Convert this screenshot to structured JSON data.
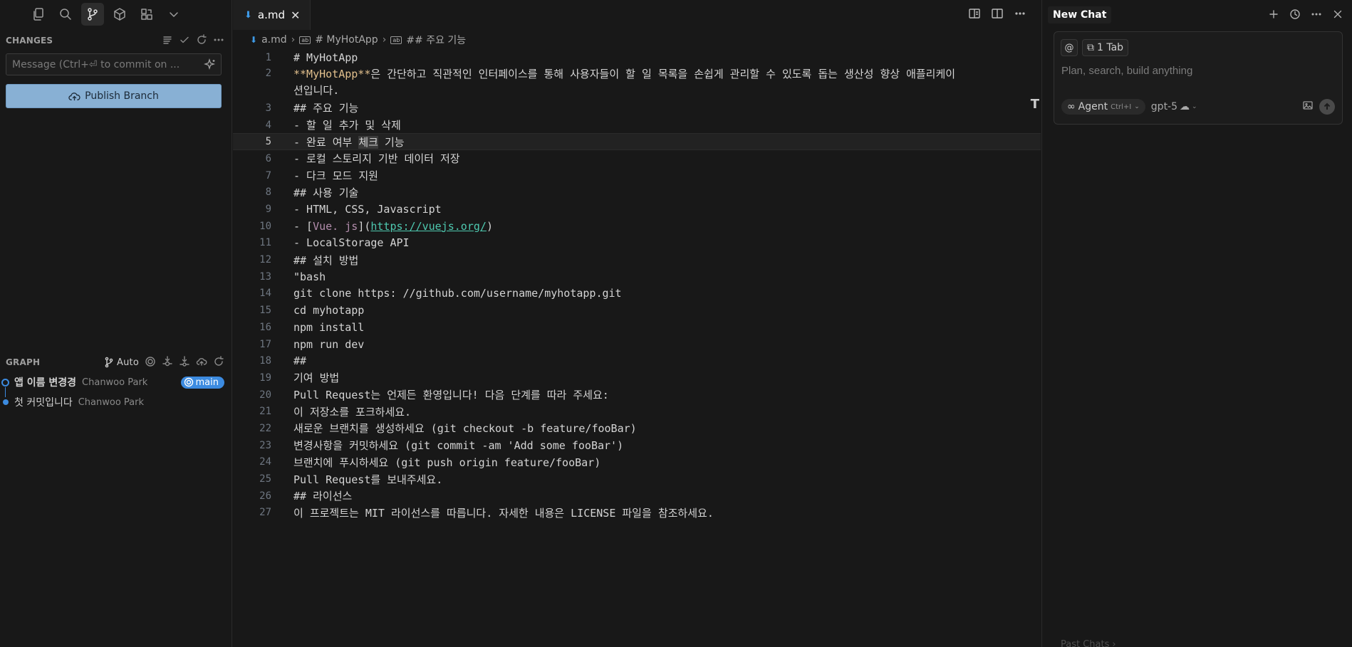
{
  "sidebar": {
    "changes_title": "CHANGES",
    "commit_placeholder": "Message (Ctrl+⏎ to commit on ...",
    "publish_label": "Publish Branch",
    "graph_title": "GRAPH",
    "graph_auto": "Auto",
    "commits": [
      {
        "message": "앱 이름 변경경",
        "author": "Chanwoo Park",
        "branch": "main"
      },
      {
        "message": "첫 커밋입니다",
        "author": "Chanwoo Park"
      }
    ]
  },
  "editor": {
    "tab_name": "a.md",
    "breadcrumb": [
      "a.md",
      "# MyHotApp",
      "## 주요 기능"
    ],
    "current_line": 5,
    "lines": [
      {
        "n": "1",
        "t": "# MyHotApp"
      },
      {
        "n": "2",
        "bold": "**MyHotApp**",
        "t": "은 간단하고 직관적인 인터페이스를 통해 사용자들이 할 일 목록을 손쉽게 관리할 수 있도록 돕는 생산성 향상 애플리케이션입니다."
      },
      {
        "n": "3",
        "t": "## 주요 기능"
      },
      {
        "n": "4",
        "t": "- 할 일 추가 및 삭제"
      },
      {
        "n": "5",
        "pre": "- 완료 여부 ",
        "hl": "체크",
        "post": " 기능"
      },
      {
        "n": "6",
        "t": "- 로컬 스토리지 기반 데이터 저장"
      },
      {
        "n": "7",
        "t": "- 다크 모드 지원"
      },
      {
        "n": "8",
        "t": "## 사용 기술"
      },
      {
        "n": "9",
        "t": "- HTML, CSS, Javascript"
      },
      {
        "n": "10",
        "pre": "- [",
        "link": "Vue. js",
        "mid": "](",
        "url": "https://vuejs.org/",
        "post": ")"
      },
      {
        "n": "11",
        "t": "- LocalStorage API"
      },
      {
        "n": "12",
        "t": "## 설치 방법"
      },
      {
        "n": "13",
        "t": "\"bash"
      },
      {
        "n": "14",
        "t": "git clone https: //github.com/username/myhotapp.git"
      },
      {
        "n": "15",
        "t": "cd myhotapp"
      },
      {
        "n": "16",
        "t": "npm install"
      },
      {
        "n": "17",
        "t": "npm run dev"
      },
      {
        "n": "18",
        "t": "##"
      },
      {
        "n": "19",
        "t": "기여 방법"
      },
      {
        "n": "20",
        "t": "Pull Request는 언제든 환영입니다! 다음 단계를 따라 주세요:"
      },
      {
        "n": "21",
        "t": "이 저장소를 포크하세요."
      },
      {
        "n": "22",
        "t": "새로운 브랜치를 생성하세요 (git checkout -b feature/fooBar)"
      },
      {
        "n": "23",
        "t": "변경사항을 커밋하세요 (git commit -am 'Add some fooBar')"
      },
      {
        "n": "24",
        "t": "브랜치에 푸시하세요 (git push origin feature/fooBar)"
      },
      {
        "n": "25",
        "t": "Pull Request를 보내주세요."
      },
      {
        "n": "26",
        "t": "## 라이선스"
      },
      {
        "n": "27",
        "t": "이 프로젝트는 MIT 라이선스를 따릅니다. 자세한 내용은 LICENSE 파일을 참조하세요."
      }
    ],
    "scroll_marker": "T"
  },
  "chat": {
    "title": "New Chat",
    "at_label": "@",
    "tab_chip": "1 Tab",
    "placeholder": "Plan, search, build anything",
    "agent_label": "Agent",
    "agent_shortcut": "Ctrl+I",
    "model_label": "gpt-5",
    "past_chats": "Past Chats"
  },
  "colors": {
    "accent": "#3c8be0",
    "publish": "#88b0d4",
    "markdown_bold": "#e2c08d",
    "link_text": "#b48ead",
    "url": "#4ec9b0"
  }
}
